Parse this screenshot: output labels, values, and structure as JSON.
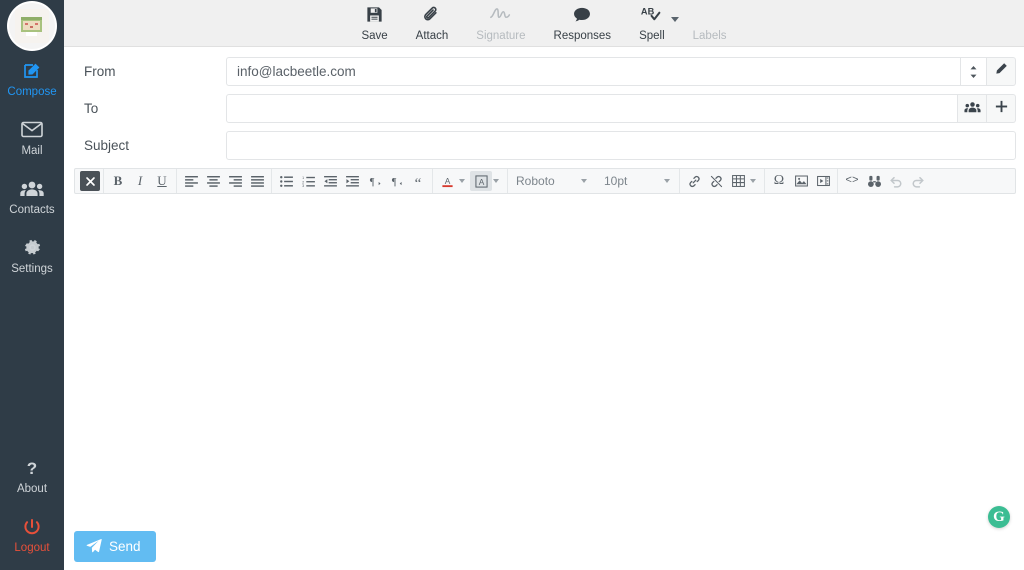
{
  "sidebar": {
    "avatar_alt": "user-avatar",
    "items": [
      {
        "icon": "compose-icon",
        "label": "Compose",
        "active": true
      },
      {
        "icon": "mail-icon",
        "label": "Mail",
        "active": false
      },
      {
        "icon": "contacts-icon",
        "label": "Contacts",
        "active": false
      },
      {
        "icon": "gear-icon",
        "label": "Settings",
        "active": false
      }
    ],
    "bottom_items": [
      {
        "icon": "question-icon",
        "label": "About"
      },
      {
        "icon": "power-icon",
        "label": "Logout"
      }
    ],
    "colors": {
      "background": "#2f3c47",
      "active": "#2196f3",
      "logout": "#e8503a"
    }
  },
  "toolbar": {
    "buttons": [
      {
        "icon": "save-icon",
        "label": "Save",
        "disabled": false
      },
      {
        "icon": "paperclip-icon",
        "label": "Attach",
        "disabled": false
      },
      {
        "icon": "signature-icon",
        "label": "Signature",
        "disabled": true
      },
      {
        "icon": "speech-bubble-icon",
        "label": "Responses",
        "disabled": false
      },
      {
        "icon": "spellcheck-icon",
        "label": "Spell",
        "disabled": false
      },
      {
        "icon": "labels-icon",
        "label": "Labels",
        "disabled": true
      }
    ],
    "spell_caret": "chevron-down-icon"
  },
  "compose": {
    "from": {
      "label": "From",
      "value": "info@lacbeetle.com",
      "placeholder": "",
      "select_icon": "select-arrows-icon",
      "edit_icon": "pencil-icon"
    },
    "to": {
      "label": "To",
      "value": "",
      "placeholder": "",
      "contacts_icon": "contacts-group-icon",
      "add_icon": "plus-icon"
    },
    "subject": {
      "label": "Subject",
      "value": "",
      "placeholder": ""
    },
    "send_label": "Send",
    "send_icon": "paper-plane-icon",
    "send_color": "#62bcf2"
  },
  "editor": {
    "font_family": "Roboto",
    "font_size": "10pt",
    "body": "",
    "groups": [
      {
        "name": "format-clear",
        "buttons": [
          {
            "icon": "remove-format-icon",
            "glyph": "✖",
            "style": "dark"
          }
        ]
      },
      {
        "name": "text-style",
        "buttons": [
          {
            "icon": "bold-icon",
            "glyph": "B",
            "style": "bold"
          },
          {
            "icon": "italic-icon",
            "glyph": "I",
            "style": "italic"
          },
          {
            "icon": "underline-icon",
            "glyph": "U",
            "style": "underline"
          }
        ]
      },
      {
        "name": "alignment",
        "buttons": [
          {
            "icon": "align-left-icon",
            "glyph": ""
          },
          {
            "icon": "align-center-icon",
            "glyph": ""
          },
          {
            "icon": "align-right-icon",
            "glyph": ""
          },
          {
            "icon": "align-justify-icon",
            "glyph": ""
          }
        ]
      },
      {
        "name": "lists-indent",
        "buttons": [
          {
            "icon": "bullet-list-icon",
            "glyph": ""
          },
          {
            "icon": "numbered-list-icon",
            "glyph": ""
          },
          {
            "icon": "outdent-icon",
            "glyph": ""
          },
          {
            "icon": "indent-icon",
            "glyph": ""
          },
          {
            "icon": "ltr-icon",
            "glyph": "¶"
          },
          {
            "icon": "rtl-icon",
            "glyph": "¶"
          },
          {
            "icon": "blockquote-icon",
            "glyph": "“"
          }
        ]
      },
      {
        "name": "colors",
        "buttons": [
          {
            "icon": "text-color-icon",
            "glyph": "A"
          },
          {
            "icon": "highlight-color-icon",
            "glyph": "A",
            "style": "active"
          }
        ]
      },
      {
        "name": "insert-link",
        "buttons": [
          {
            "icon": "link-icon",
            "glyph": "🔗"
          },
          {
            "icon": "unlink-icon",
            "glyph": "🔗"
          },
          {
            "icon": "table-icon",
            "glyph": ""
          }
        ]
      },
      {
        "name": "insert-media",
        "buttons": [
          {
            "icon": "special-character-icon",
            "glyph": "Ω"
          },
          {
            "icon": "image-icon",
            "glyph": ""
          },
          {
            "icon": "video-icon",
            "glyph": ""
          }
        ]
      },
      {
        "name": "tools",
        "buttons": [
          {
            "icon": "source-code-icon",
            "glyph": "<>"
          },
          {
            "icon": "find-replace-icon",
            "glyph": ""
          },
          {
            "icon": "undo-icon",
            "glyph": "↶",
            "disabled": true
          },
          {
            "icon": "redo-icon",
            "glyph": "↷",
            "disabled": true
          }
        ]
      }
    ]
  },
  "assistant": {
    "icon": "grammar-assistant-icon",
    "letter": "G",
    "color": "#3bbd93"
  }
}
